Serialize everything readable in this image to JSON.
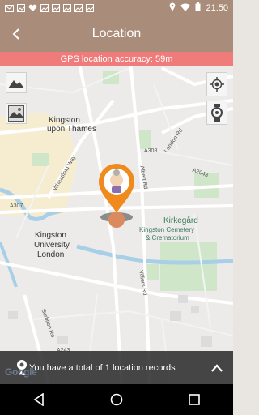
{
  "status_bar": {
    "time": "21:50",
    "icons": [
      "mail-icon",
      "image-icon",
      "heart-icon",
      "image-icon",
      "image-icon",
      "image-icon",
      "image-icon",
      "image-icon",
      "location-icon",
      "wifi-icon",
      "battery-icon"
    ]
  },
  "app_bar": {
    "title": "Location",
    "back_icon": "back-arrow-icon"
  },
  "banner": {
    "accuracy_text": "GPS location accuracy: 59m",
    "color": "#f07b7b"
  },
  "map": {
    "labels": {
      "kingston": "Kingston",
      "upon_thames": "upon Thames",
      "kingston_uni_1": "Kingston",
      "kingston_uni_2": "University",
      "kingston_uni_3": "London",
      "kirkegard": "Kirkegård",
      "cemetery_1": "Kingston Cemetery",
      "cemetery_2": "& Crematorium",
      "london_rd": "London Rd",
      "albert_rd": "Albert Rd",
      "wheatfield_way": "Wheatfield Way",
      "villiers_rd": "Villiers Rd",
      "surbiton_rd": "Surbiton Rd",
      "a307": "A307",
      "a308": "A308",
      "a2043": "A2043",
      "a243": "A243"
    },
    "tools": {
      "layers_top": "landscape-icon",
      "layers_bottom": "terrain-icon",
      "locate_me": "my-location-icon",
      "watch": "watch-icon"
    }
  },
  "bottom_bar": {
    "records_text": "You have a total of 1 location records",
    "google": "Google"
  },
  "colors": {
    "app_bar": "#a98c79",
    "marker": "#f08a1c"
  }
}
